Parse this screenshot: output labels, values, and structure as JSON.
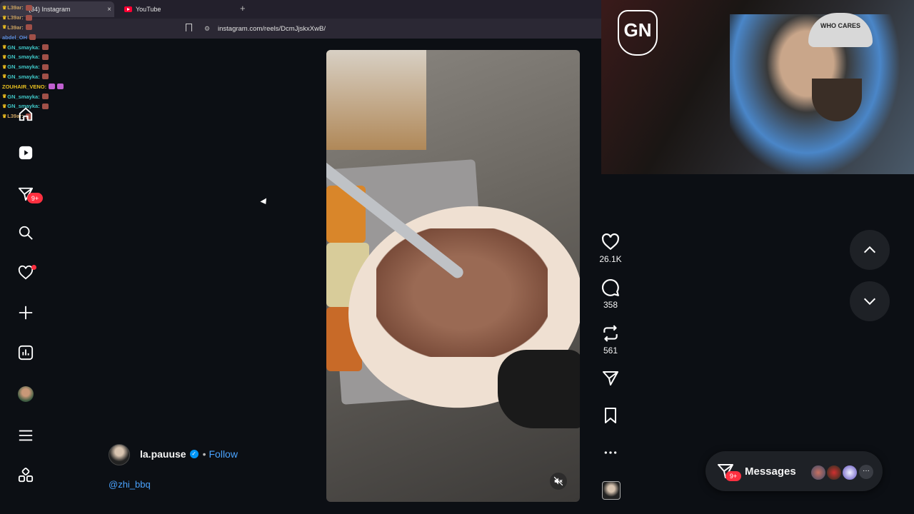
{
  "browser": {
    "tabs": [
      {
        "label": "(34) Instagram",
        "active": true
      },
      {
        "label": "YouTube",
        "active": false
      }
    ],
    "new_tab": "+",
    "close": "×",
    "url": "instagram.com/reels/DcmJjskxXwB/"
  },
  "chat": [
    {
      "user": "L39ar:",
      "color": "#c8a060"
    },
    {
      "user": "L39ar:",
      "color": "#c8a060"
    },
    {
      "user": "L39ar:",
      "color": "#c8a060"
    },
    {
      "user": "abdel_OH",
      "color": "#5a8ad8"
    },
    {
      "user": "GN_smayka:",
      "color": "#40c8c8"
    },
    {
      "user": "GN_smayka:",
      "color": "#40c8c8"
    },
    {
      "user": "GN_smayka:",
      "color": "#40c8c8"
    },
    {
      "user": "GN_smayka:",
      "color": "#40c8c8"
    },
    {
      "user": "ZOUHAIR_VENO:",
      "color": "#e8c020"
    },
    {
      "user": "GN_smayka:",
      "color": "#40c8c8"
    },
    {
      "user": "GN_smayka:",
      "color": "#40c8c8"
    },
    {
      "user": "L39ar:",
      "color": "#c8a060"
    }
  ],
  "nav": {
    "notifications_badge": "9+",
    "items": [
      "home-icon",
      "reels-icon",
      "messages-icon",
      "search-icon",
      "notifications-icon",
      "create-icon",
      "dashboard-icon",
      "profile-avatar",
      "menu-icon",
      "more-apps-icon"
    ]
  },
  "reel": {
    "author": "la.pauuse",
    "separator": "•",
    "follow": "Follow",
    "mention": "@zhi_bbq",
    "likes": "26.1K",
    "comments": "358",
    "reposts": "561"
  },
  "webcam": {
    "logo": "GN",
    "cap_text": "WHO CARES"
  },
  "messages": {
    "label": "Messages",
    "badge": "9+",
    "more": "···"
  },
  "colors": {
    "background": "#0c0f14",
    "accent": "#0095f6",
    "badge": "#ff3040",
    "link": "#4aa3ff"
  }
}
